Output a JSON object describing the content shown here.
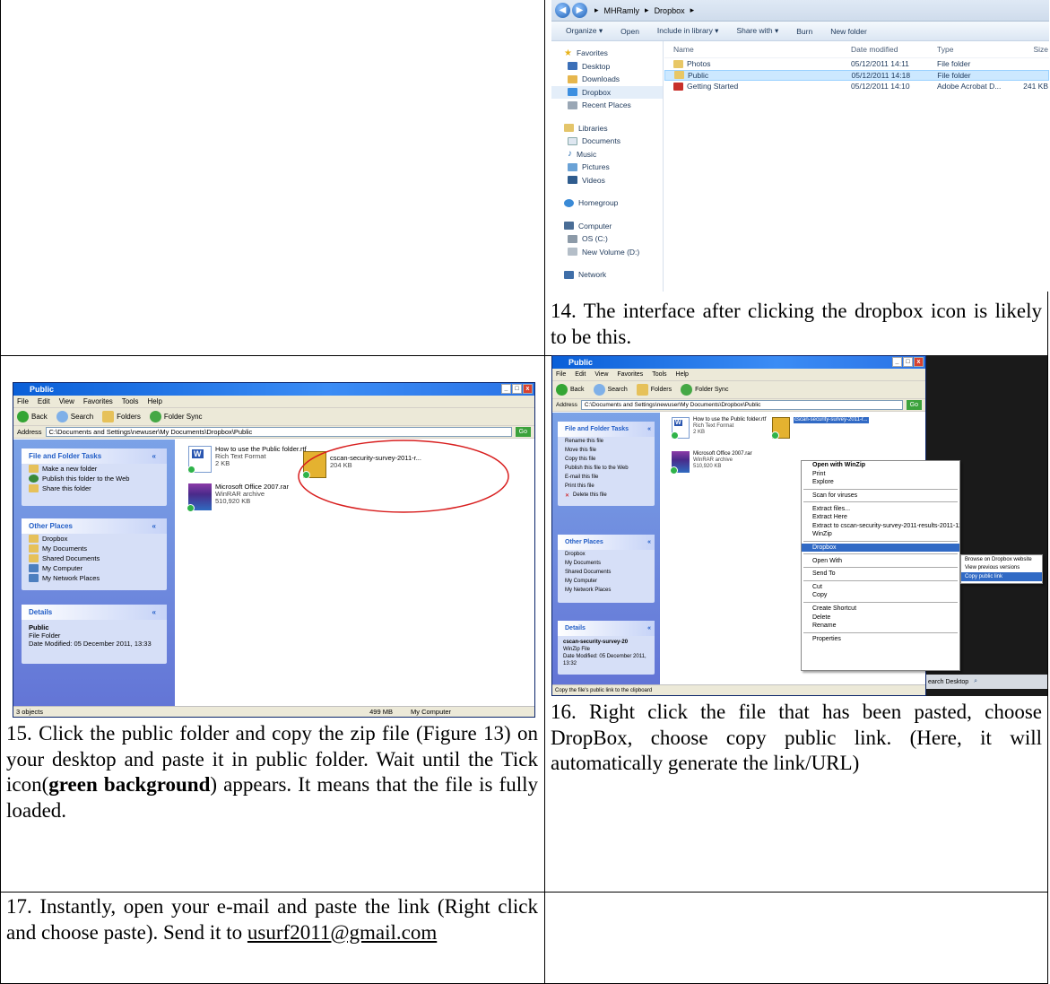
{
  "explorer_win7": {
    "breadcrumb": [
      "MHRamly",
      "Dropbox"
    ],
    "toolbar": [
      "Organize ▾",
      "Open",
      "Include in library ▾",
      "Share with ▾",
      "Burn",
      "New folder"
    ],
    "nav": {
      "favorites": "Favorites",
      "fav_items": [
        "Desktop",
        "Downloads",
        "Dropbox",
        "Recent Places"
      ],
      "libraries": "Libraries",
      "lib_items": [
        "Documents",
        "Music",
        "Pictures",
        "Videos"
      ],
      "homegroup": "Homegroup",
      "computer": "Computer",
      "comp_items": [
        "OS (C:)",
        "New Volume (D:)"
      ],
      "network": "Network"
    },
    "columns": {
      "name": "Name",
      "date": "Date modified",
      "type": "Type",
      "size": "Size"
    },
    "rows": [
      {
        "name": "Photos",
        "date": "05/12/2011 14:11",
        "type": "File folder",
        "size": ""
      },
      {
        "name": "Public",
        "date": "05/12/2011 14:18",
        "type": "File folder",
        "size": ""
      },
      {
        "name": "Getting Started",
        "date": "05/12/2011 14:10",
        "type": "Adobe Acrobat D...",
        "size": "241 KB"
      }
    ]
  },
  "captions": {
    "c14": "14. The interface after clicking the dropbox icon is likely to be this.",
    "c15_a": "15. Click the public folder and copy the zip file (Figure 13) on your desktop and paste it in public folder. Wait until the Tick icon(",
    "c15_b": "green background",
    "c15_c": ") appears. It means that the file is fully loaded.",
    "c16": "16. Right click the file that has been pasted, choose DropBox, choose copy public link. (Here, it will automatically generate the link/URL)",
    "c17_a": "17. Instantly, open your e-mail and paste the link (Right click and choose paste). Send it to ",
    "c17_email": "usurf2011@gmail.com"
  },
  "xp_left": {
    "title": "Public",
    "menu": [
      "File",
      "Edit",
      "View",
      "Favorites",
      "Tools",
      "Help"
    ],
    "tools": [
      "Back",
      "Search",
      "Folders",
      "Folder Sync"
    ],
    "address_label": "Address",
    "address": "C:\\Documents and Settings\\newuser\\My Documents\\Dropbox\\Public",
    "go": "Go",
    "panels": {
      "tasks_title": "File and Folder Tasks",
      "tasks": [
        "Make a new folder",
        "Publish this folder to the Web",
        "Share this folder"
      ],
      "places_title": "Other Places",
      "places": [
        "Dropbox",
        "My Documents",
        "Shared Documents",
        "My Computer",
        "My Network Places"
      ],
      "details_title": "Details",
      "details_name": "Public",
      "details_type": "File Folder",
      "details_date": "Date Modified: 05 December 2011, 13:33"
    },
    "files": [
      {
        "name": "How to use the Public folder.rtf",
        "type": "Rich Text Format",
        "size": "2 KB"
      },
      {
        "name": "cscan-security-survey-2011-r...",
        "type": "",
        "size": "204 KB"
      },
      {
        "name": "Microsoft Office 2007.rar",
        "type": "WinRAR archive",
        "size": "510,920 KB"
      }
    ],
    "status_left": "3 objects",
    "status_size": "499 MB",
    "status_right": "My Computer"
  },
  "xp_right": {
    "title": "Public",
    "menu": [
      "File",
      "Edit",
      "View",
      "Favorites",
      "Tools",
      "Help"
    ],
    "tools": [
      "Back",
      "Search",
      "Folders",
      "Folder Sync"
    ],
    "address_label": "Address",
    "address": "C:\\Documents and Settings\\newuser\\My Documents\\Dropbox\\Public",
    "go": "Go",
    "panels": {
      "tasks_title": "File and Folder Tasks",
      "tasks": [
        "Rename this file",
        "Move this file",
        "Copy this file",
        "Publish this file to the Web",
        "E-mail this file",
        "Print this file",
        "Delete this file"
      ],
      "places_title": "Other Places",
      "places": [
        "Dropbox",
        "My Documents",
        "Shared Documents",
        "My Computer",
        "My Network Places"
      ],
      "details_title": "Details",
      "details_name": "cscan-security-survey-20",
      "details_type": "WinZip File",
      "details_date": "Date Modified: 05 December 2011, 13:32"
    },
    "files": [
      {
        "name": "How to use the Public folder.rtf",
        "type": "Rich Text Format",
        "size": "2 KB"
      },
      {
        "name": "cscan-security-survey-2011-r...",
        "type": "",
        "size": ""
      },
      {
        "name": "Microsoft Office 2007.rar",
        "type": "WinRAR archive",
        "size": "510,920 KB"
      }
    ],
    "context_menu": [
      "Open with WinZip",
      "Print",
      "Explore",
      "|",
      "Scan for viruses",
      "|",
      "Extract files...",
      "Extract Here",
      "Extract to cscan-security-survey-2011-results-2011-12-05\\",
      "WinZip",
      "|",
      "Dropbox",
      "|",
      "Open With",
      "|",
      "Send To",
      "|",
      "Cut",
      "Copy",
      "|",
      "Create Shortcut",
      "Delete",
      "Rename",
      "|",
      "Properties"
    ],
    "submenu": [
      "Browse on Dropbox website",
      "View previous versions",
      "Copy public link"
    ],
    "search_desktop": "earch Desktop",
    "status_left": "Copy the file's public link to the clipboard"
  }
}
